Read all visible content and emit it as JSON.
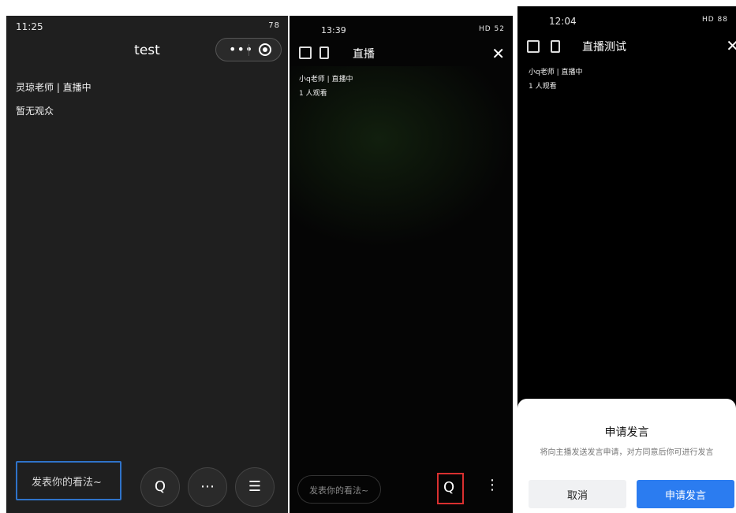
{
  "phone1": {
    "status_time": "11:25",
    "status_right": "78",
    "title": "test",
    "host": "灵琼老师 | 直播中",
    "audience": "暂无观众",
    "comment_placeholder": "发表你的看法~",
    "icons": {
      "more": "ellipsis-icon",
      "target": "target-icon",
      "apply_speak": "mic-bubble-icon",
      "menu": "more-icon",
      "viewers": "eye-list-icon"
    }
  },
  "phone2": {
    "status_time": "13:39",
    "status_right": "HD 52",
    "title": "直播",
    "host": "小q老师 | 直播中",
    "audience": "1 人观看",
    "comment_placeholder": "发表你的看法~",
    "highlight_color": "#d93030"
  },
  "phone3": {
    "status_time": "12:04",
    "status_right": "HD 88",
    "title": "直播测试",
    "host": "小q老师 | 直播中",
    "audience": "1 人观看",
    "dialog": {
      "title": "申请发言",
      "description": "将向主播发送发言申请，对方同意后你可进行发言",
      "cancel_label": "取消",
      "confirm_label": "申请发言",
      "confirm_color": "#2b7cf0"
    }
  }
}
